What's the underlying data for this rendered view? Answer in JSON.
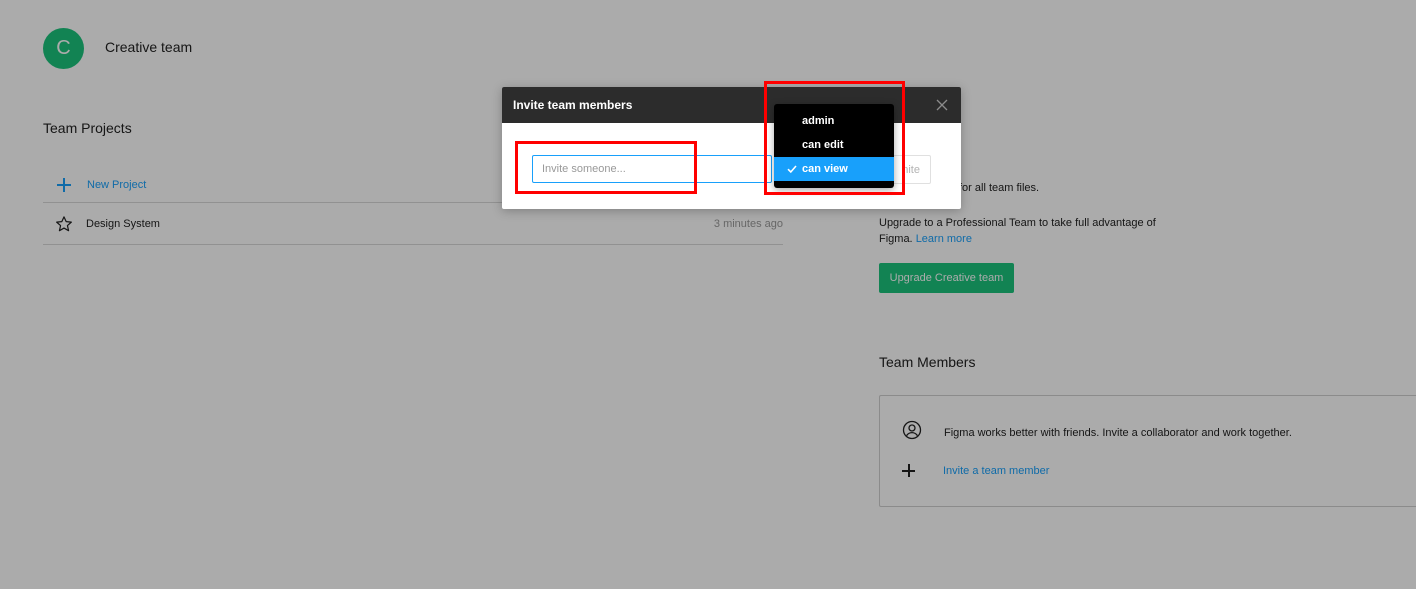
{
  "team": {
    "avatar_letter": "C",
    "name": "Creative team"
  },
  "projects": {
    "title": "Team Projects",
    "new_project_label": "New Project",
    "items": [
      {
        "name": "Design System",
        "time": "3 minutes ago"
      }
    ]
  },
  "plan": {
    "plan_text": "for all team files.",
    "upgrade_text": "Upgrade to a Professional Team to take full advantage of Figma.",
    "learn_more": "Learn more",
    "upgrade_button": "Upgrade Creative team"
  },
  "members": {
    "title": "Team Members",
    "hint": "Figma works better with friends. Invite a collaborator and work together.",
    "invite_link": "Invite a team member"
  },
  "modal": {
    "title": "Invite team members",
    "input_placeholder": "Invite someone...",
    "send_button": "nite"
  },
  "permission_dropdown": {
    "options": [
      "admin",
      "can edit",
      "can view"
    ],
    "selected": "can view"
  },
  "colors": {
    "brand_green": "#1bc47d",
    "accent_blue": "#18a0fb",
    "highlight_red": "#ff0000",
    "modal_header": "#2c2c2c"
  }
}
